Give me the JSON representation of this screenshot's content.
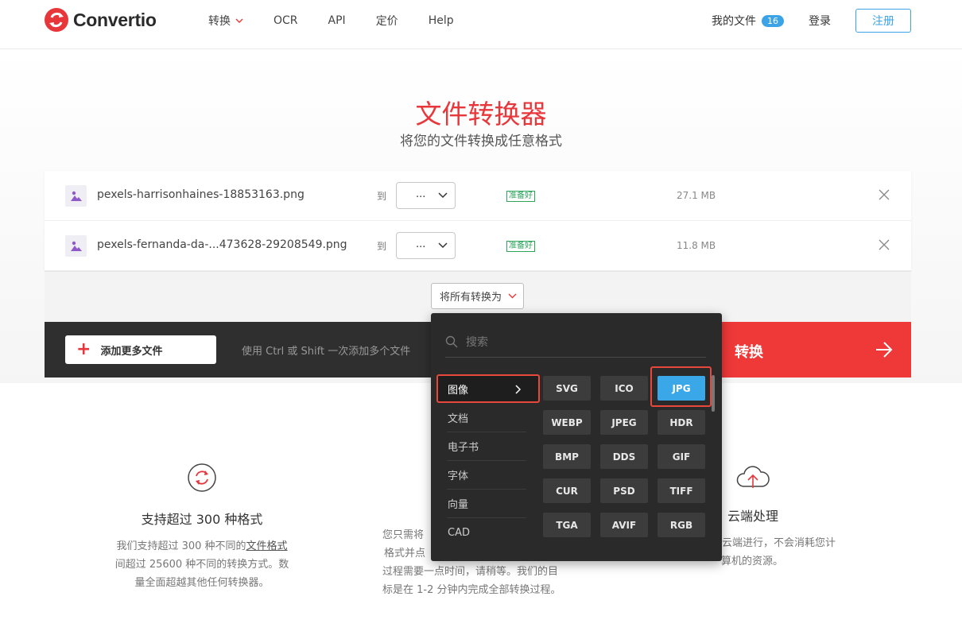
{
  "header": {
    "brand": "Convertio",
    "nav": [
      "转换",
      "OCR",
      "API",
      "定价",
      "Help"
    ],
    "my_files": "我的文件",
    "my_files_count": "16",
    "login": "登录",
    "signup": "注册"
  },
  "hero": {
    "title": "文件转换器",
    "subtitle": "将您的文件转换成任意格式"
  },
  "files": [
    {
      "name": "pexels-harrisonhaines-18853163.png",
      "to": "到",
      "format": "...",
      "status": "准备好",
      "size": "27.1 MB"
    },
    {
      "name": "pexels-fernanda-da-...473628-29208549.png",
      "to": "到",
      "format": "...",
      "status": "准备好",
      "size": "11.8 MB"
    }
  ],
  "convert_all": "将所有转换为",
  "actions": {
    "add_more": "添加更多文件",
    "hint": "使用 Ctrl 或 Shift 一次添加多个文件",
    "convert": "转换"
  },
  "dropdown": {
    "search_placeholder": "搜索",
    "categories": [
      "图像",
      "文档",
      "电子书",
      "字体",
      "向量",
      "CAD"
    ],
    "formats": [
      "SVG",
      "ICO",
      "JPG",
      "WEBP",
      "JPEG",
      "HDR",
      "BMP",
      "DDS",
      "GIF",
      "CUR",
      "PSD",
      "TIFF",
      "TGA",
      "AVIF",
      "RGB"
    ],
    "selected_format": "JPG"
  },
  "features": [
    {
      "title": "支持超过 300 种格式",
      "lines": [
        "我们支持超过 300 种不同的",
        "文件格式",
        "间超过 25600 种不同的转换方式。数",
        "量全面超越其他任何转换器。"
      ]
    },
    {
      "title": "",
      "lines": [
        "您只需将",
        "格式并点",
        "过程需要一点时间，请稍等。我们的目",
        "标是在 1-2 分钟内完成全部转换过程。"
      ]
    },
    {
      "title": "云端处理",
      "lines": [
        "在云端进行，不会消耗您计",
        "算机的资源。"
      ]
    }
  ],
  "colors": {
    "brand_red": "#e8373b",
    "accent_blue": "#3ba3e6",
    "ready_green": "#2aa55a"
  }
}
